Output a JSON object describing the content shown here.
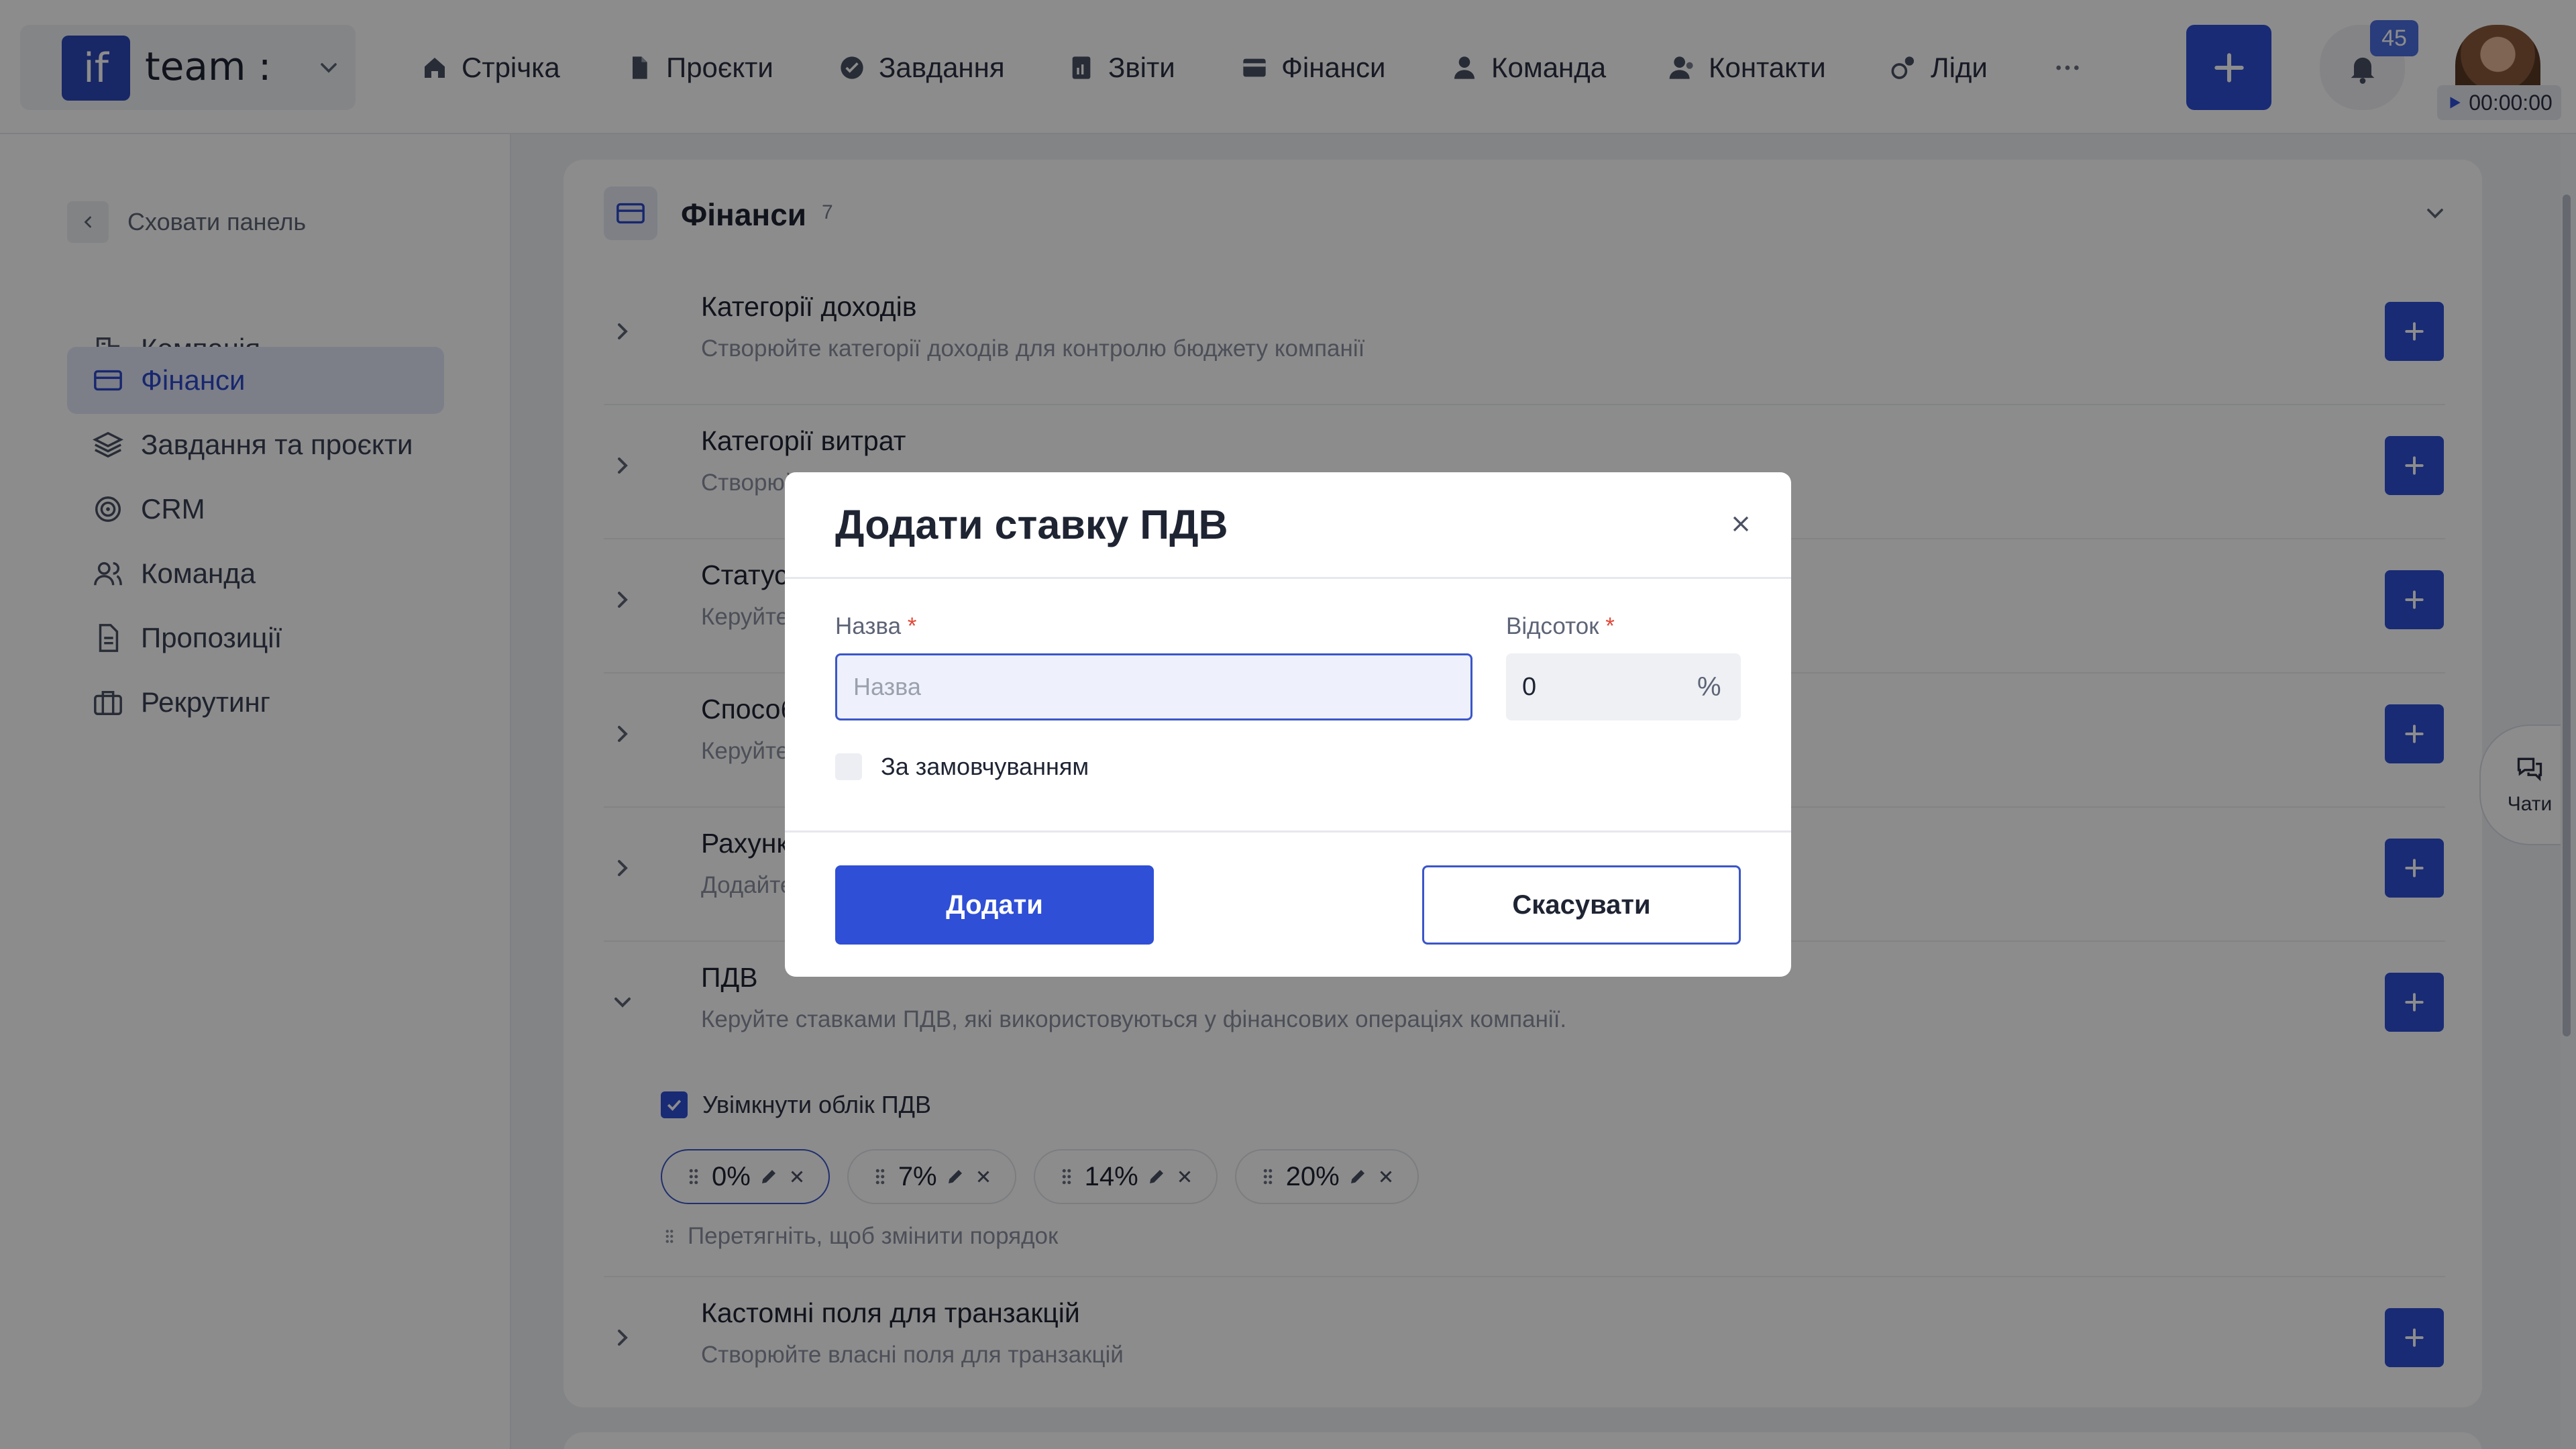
{
  "brand": {
    "logo_text": "if",
    "name": "team :"
  },
  "nav": [
    {
      "label": "Стрічка",
      "icon": "home-icon"
    },
    {
      "label": "Проєкти",
      "icon": "document-icon"
    },
    {
      "label": "Завдання",
      "icon": "check-circle-icon"
    },
    {
      "label": "Звіти",
      "icon": "report-icon"
    },
    {
      "label": "Фінанси",
      "icon": "wallet-icon"
    },
    {
      "label": "Команда",
      "icon": "user-icon"
    },
    {
      "label": "Контакти",
      "icon": "contacts-icon"
    },
    {
      "label": "Ліди",
      "icon": "leads-icon"
    }
  ],
  "header": {
    "notifications_count": "45",
    "timer": "00:00:00"
  },
  "sidebar": {
    "hide_label": "Сховати панель",
    "items": [
      {
        "label": "Компанія",
        "icon": "company-icon",
        "active": false
      },
      {
        "label": "Фінанси",
        "icon": "card-icon",
        "active": true
      },
      {
        "label": "Завдання та проєкти",
        "icon": "layers-icon",
        "active": false
      },
      {
        "label": "CRM",
        "icon": "target-icon",
        "active": false
      },
      {
        "label": "Команда",
        "icon": "team-icon",
        "active": false
      },
      {
        "label": "Пропозиції",
        "icon": "proposal-icon",
        "active": false
      },
      {
        "label": "Рекрутинг",
        "icon": "briefcase-icon",
        "active": false
      }
    ]
  },
  "section": {
    "title": "Фінанси",
    "count": "7",
    "rows": [
      {
        "title": "Категорії доходів",
        "subtitle": "Створюйте категорії доходів для контролю бюджету компанії"
      },
      {
        "title": "Категорії витрат",
        "subtitle": "Створюйте"
      },
      {
        "title": "Статуси т",
        "subtitle": "Керуйте ст"
      },
      {
        "title": "Способи с",
        "subtitle": "Керуйте сп"
      },
      {
        "title": "Рахунки к",
        "subtitle": "Додайте но"
      },
      {
        "title": "ПДВ",
        "subtitle": "Керуйте ставками ПДВ, які використовуються у фінансових операціях компанії."
      },
      {
        "title": "Кастомні поля для транзакцій",
        "subtitle": "Створюйте власні поля для транзакцій"
      }
    ],
    "vat": {
      "enable_label": "Увімкнути облік ПДВ",
      "enabled": true,
      "rates": [
        "0%",
        "7%",
        "14%",
        "20%"
      ],
      "drag_hint": "Перетягніть, щоб змінити порядок"
    }
  },
  "chat": {
    "label": "Чати"
  },
  "modal": {
    "title": "Додати ставку ПДВ",
    "name_label": "Назва",
    "name_placeholder": "Назва",
    "percent_label": "Відсоток",
    "percent_value": "0",
    "percent_symbol": "%",
    "default_label": "За замовчуванням",
    "add_button": "Додати",
    "cancel_button": "Скасувати",
    "required_mark": "*"
  },
  "colors": {
    "accent": "#2f4fd6",
    "active_bg": "#e2e7f8",
    "required": "#e04a3a"
  }
}
